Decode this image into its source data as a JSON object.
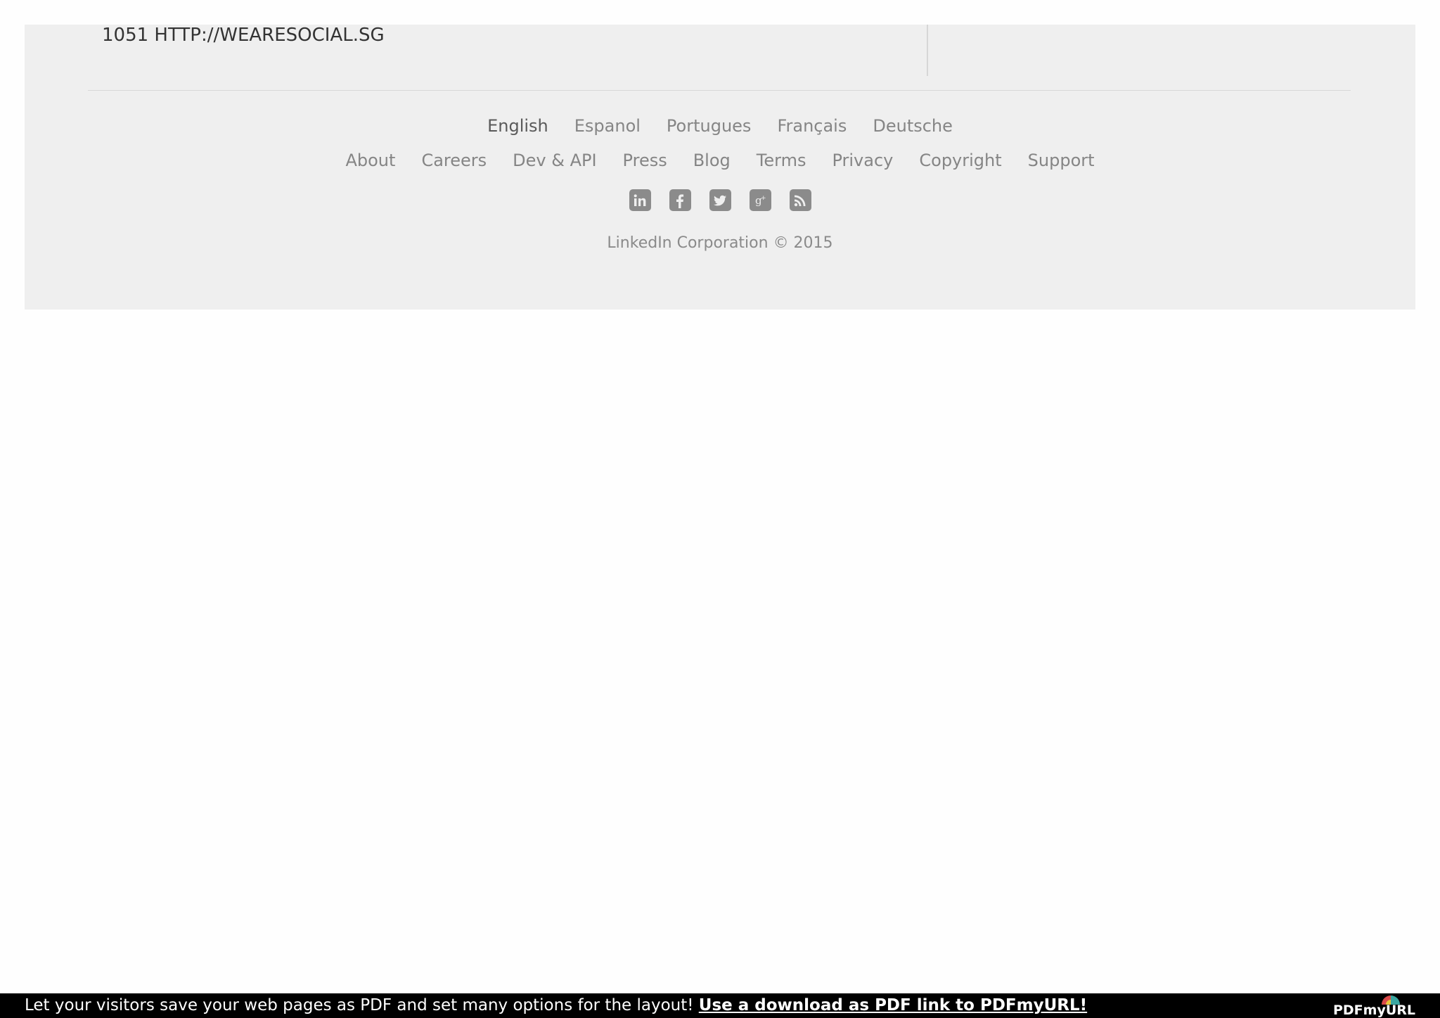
{
  "footer": {
    "url_line": "1051 HTTP://WEARESOCIAL.SG",
    "languages": [
      {
        "label": "English",
        "active": true
      },
      {
        "label": "Espanol",
        "active": false
      },
      {
        "label": "Portugues",
        "active": false
      },
      {
        "label": "Français",
        "active": false
      },
      {
        "label": "Deutsche",
        "active": false
      }
    ],
    "links": [
      {
        "label": "About"
      },
      {
        "label": "Careers"
      },
      {
        "label": "Dev & API"
      },
      {
        "label": "Press"
      },
      {
        "label": "Blog"
      },
      {
        "label": "Terms"
      },
      {
        "label": "Privacy"
      },
      {
        "label": "Copyright"
      },
      {
        "label": "Support"
      }
    ],
    "social_icons": [
      "linkedin-icon",
      "facebook-icon",
      "twitter-icon",
      "google-plus-icon",
      "rss-icon"
    ],
    "copyright": "LinkedIn Corporation © 2015"
  },
  "promo_bar": {
    "text": "Let your visitors save your web pages as PDF and set many options for the layout! ",
    "link_text": "Use a download as PDF link to PDFmyURL!",
    "logo_text": "PDFmyURL"
  },
  "colors": {
    "footer_bg": "#efefef",
    "link_gray": "#858585",
    "active_gray": "#5a5a5a",
    "promo_bg": "#000000"
  }
}
